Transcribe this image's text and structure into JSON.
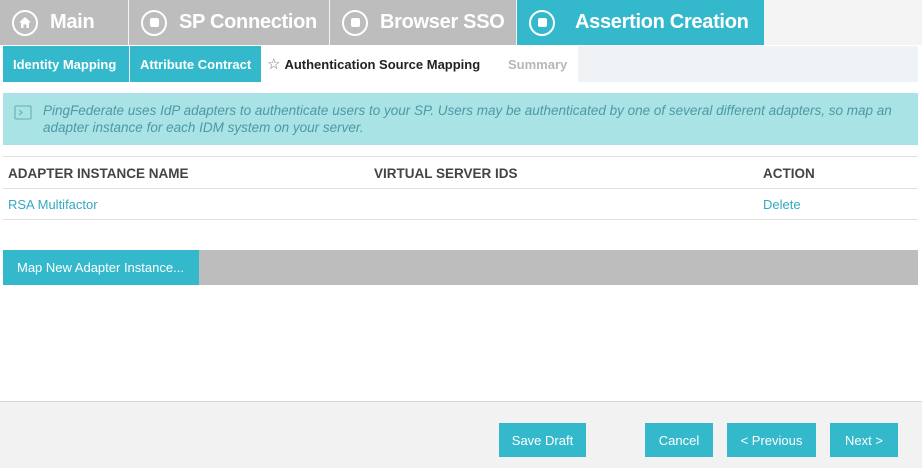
{
  "top_tabs": [
    {
      "label": "Main",
      "state": "inactive"
    },
    {
      "label": "SP Connection",
      "state": "inactive"
    },
    {
      "label": "Browser SSO",
      "state": "inactive"
    },
    {
      "label": "Assertion Creation",
      "state": "active"
    }
  ],
  "sub_tabs": [
    {
      "label": "Identity Mapping",
      "state": "done"
    },
    {
      "label": "Attribute Contract",
      "state": "done"
    },
    {
      "label": "Authentication Source Mapping",
      "state": "current"
    },
    {
      "label": "Summary",
      "state": "disabled"
    }
  ],
  "info": {
    "icon": "message-icon",
    "text": "PingFederate uses IdP adapters to authenticate users to your SP. Users may be authenticated by one of several different adapters, so map an adapter instance for each IDM system on your server."
  },
  "table": {
    "headers": [
      "ADAPTER INSTANCE NAME",
      "VIRTUAL SERVER IDS",
      "ACTION"
    ],
    "rows": [
      {
        "name": "RSA Multifactor",
        "virtual_ids": "",
        "action": "Delete"
      }
    ]
  },
  "map_button": "Map New Adapter Instance...",
  "footer": {
    "save_draft": "Save Draft",
    "cancel": "Cancel",
    "previous": "< Previous",
    "next": "Next >"
  },
  "colors": {
    "accent": "#34b9cc",
    "inactive_tab": "#bdbdbd",
    "info_bg": "#a9e3e6",
    "link": "#34a8c4"
  }
}
